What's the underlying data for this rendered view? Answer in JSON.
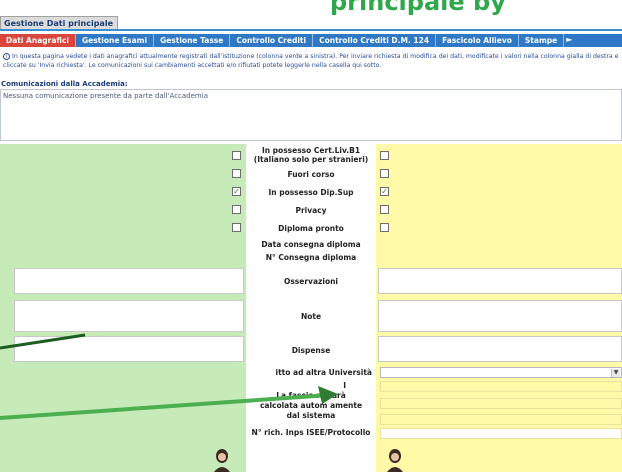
{
  "header": {
    "title": "Gestione Dati principale",
    "banner_text": "principale by"
  },
  "tabs": [
    {
      "label": "Dati Anagrafici",
      "active": true
    },
    {
      "label": "Gestione Esami",
      "active": false
    },
    {
      "label": "Gestione Tasse",
      "active": false
    },
    {
      "label": "Controllo Crediti",
      "active": false
    },
    {
      "label": "Controllo Crediti D.M. 124",
      "active": false
    },
    {
      "label": "Fascicolo Allievo",
      "active": false
    },
    {
      "label": "Stampe",
      "active": false
    }
  ],
  "info": {
    "text": "In questa pagina vedete i dati anagrafici attualmente registrati dall'istituzione (colonna verde a sinistra). Per inviare richiesta di modifica dei dati, modificate i valori nella colonna gialla di destra e cliccate su 'Invia richiesta'. Le comunicazioni sui cambiamenti accettati e/o rifiutati potete leggerle nella casella qui sotto."
  },
  "communications": {
    "label": "Comunicazioni dalla Accademia:",
    "text": "Nessuna comunicazione presente da parte dall'Accademia"
  },
  "rows": {
    "cert_b1_line1": "In possesso Cert.Liv.B1",
    "cert_b1_line2": "(Italiano solo per stranieri)",
    "fuori_corso": "Fuori corso",
    "dip_sup": "In possesso Dip.Sup",
    "privacy": "Privacy",
    "diploma_pronto": "Diploma pronto",
    "data_consegna": "Data consegna diploma",
    "n_consegna": "N° Consegna diploma",
    "osservazioni": "Osservazioni",
    "note": "Note",
    "dispense": "Dispense",
    "iscritto": "itto ad altra Università",
    "fascia_line1": "I",
    "fascia_line2": "La fascia re        sarà",
    "fascia_line3": "calcolata autom    amente",
    "fascia_line4": "dal sistema",
    "isee": "N° rich. Inps ISEE/Protocollo"
  },
  "checkboxes": {
    "cert_b1_left": false,
    "cert_b1_right": false,
    "fuori_corso_left": false,
    "fuori_corso_right": false,
    "dip_sup_left": true,
    "dip_sup_right": true,
    "privacy_left": false,
    "privacy_right": false,
    "diploma_pronto_left": false,
    "diploma_pronto_right": false
  },
  "check_glyph": "☑",
  "colors": {
    "tab_bar": "#2f78c5",
    "tab_active": "#d9463b",
    "current_column": "#c6ebb9",
    "request_column": "#fefaa8",
    "annotation_arrow": "#2e7d32"
  }
}
